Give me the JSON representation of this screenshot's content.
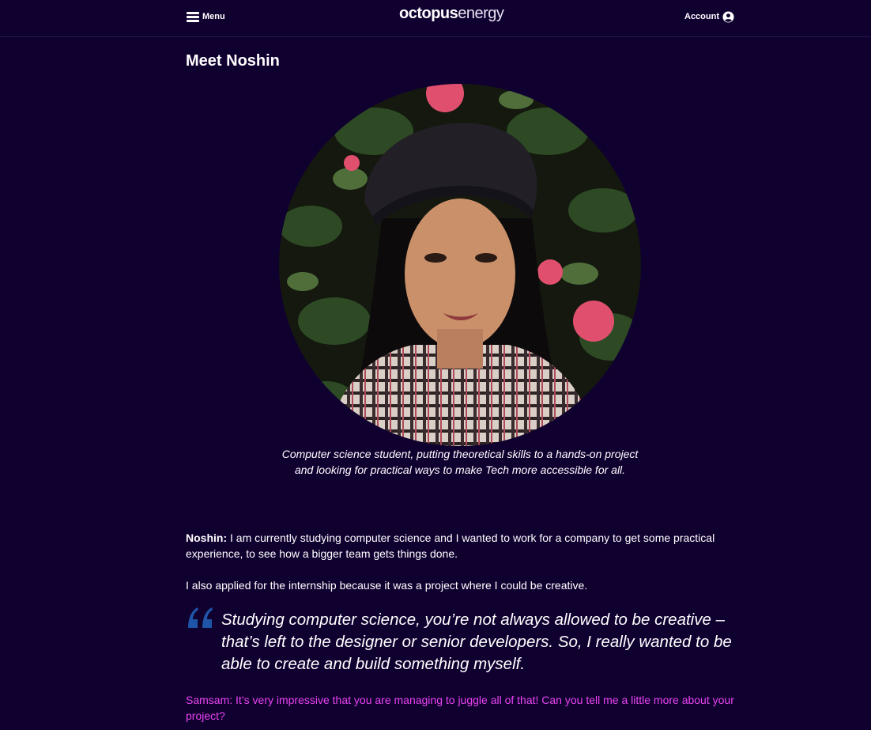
{
  "header": {
    "menu_label": "Menu",
    "logo_bold": "octopus",
    "logo_light": "energy",
    "account_label": "Account"
  },
  "article": {
    "title": "Meet Noshin",
    "photo_caption": "Computer science student, putting theoretical skills to a hands-on project and looking for practical ways to make Tech more accessible for all.",
    "answer1_speaker": "Noshin:",
    "answer1_text": " I am currently studying computer science and I wanted to work for a company to get some practical experience, to see how a bigger team gets things done.",
    "answer2_text": "I also applied for the internship because it was a project where I could be creative.",
    "pull_quote": "Studying computer science, you’re not always allowed to be creative – that’s left to the designer or senior developers. So, I really wanted to be able to create and build something myself.",
    "interviewer_question": "Samsam: It’s very impressive that you are managing to juggle all of that! Can you tell me a little more about your project?"
  },
  "colors": {
    "background": "#100030",
    "question_text": "#ec43f2",
    "quote_mark": "#1f55a8"
  },
  "icons": {
    "menu": "hamburger-icon",
    "account": "user-circle-icon",
    "quote": "open-quote-icon"
  }
}
